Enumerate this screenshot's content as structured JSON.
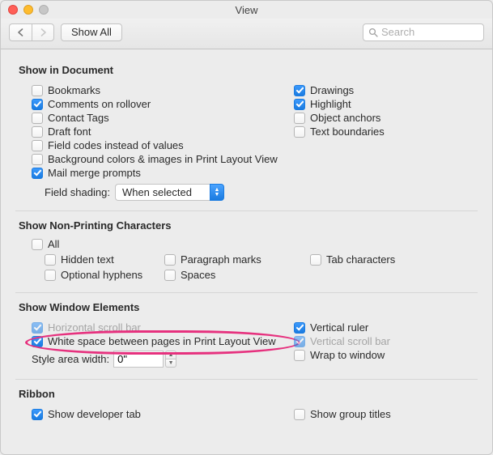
{
  "window": {
    "title": "View"
  },
  "toolbar": {
    "showAll": "Show All",
    "searchPlaceholder": "Search"
  },
  "sections": {
    "doc": {
      "title": "Show in Document",
      "bookmarks": "Bookmarks",
      "drawings": "Drawings",
      "commentsRollover": "Comments on rollover",
      "highlight": "Highlight",
      "contactTags": "Contact Tags",
      "objectAnchors": "Object anchors",
      "draftFont": "Draft font",
      "textBoundaries": "Text boundaries",
      "fieldCodes": "Field codes instead of values",
      "bgColors": "Background colors & images in Print Layout View",
      "mailMerge": "Mail merge prompts",
      "fieldShadingLabel": "Field shading:",
      "fieldShadingValue": "When selected"
    },
    "nonprint": {
      "title": "Show Non-Printing Characters",
      "all": "All",
      "hidden": "Hidden text",
      "para": "Paragraph marks",
      "tab": "Tab characters",
      "hyphen": "Optional hyphens",
      "spaces": "Spaces"
    },
    "winel": {
      "title": "Show Window Elements",
      "hscroll": "Horizontal scroll bar",
      "vruler": "Vertical ruler",
      "whitespace": "White space between pages in Print Layout View",
      "vscroll": "Vertical scroll bar",
      "styleAreaLabel": "Style area width:",
      "styleAreaValue": "0\"",
      "wrap": "Wrap to window"
    },
    "ribbon": {
      "title": "Ribbon",
      "devtab": "Show developer tab",
      "grouptitles": "Show group titles"
    }
  }
}
